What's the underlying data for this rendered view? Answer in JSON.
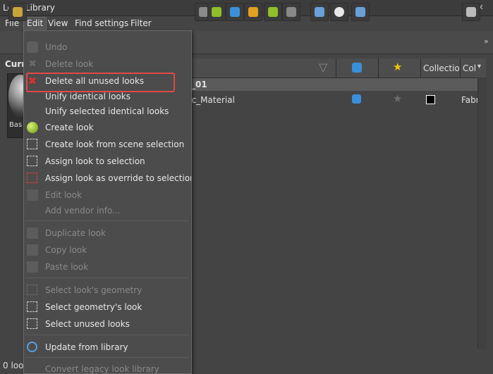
{
  "window": {
    "title": "Look Library"
  },
  "menubar": {
    "file": "File",
    "edit": "Edit",
    "view": "View",
    "find": "Find settings",
    "filter": "Filter"
  },
  "left": {
    "current_label": "Curr",
    "thumb_label": "Bas"
  },
  "table": {
    "group_label": "_01",
    "row_name": "sic_Material",
    "header_collection": "Collectio",
    "header_col": "Col",
    "row_col": "Fabric"
  },
  "status": "0 loo",
  "edit_menu": {
    "undo": "Undo",
    "delete_look": "Delete look",
    "delete_all_unused": "Delete all unused looks",
    "unify_identical": "Unify identical looks",
    "unify_selected": "Unify selected identical looks",
    "create_look": "Create look",
    "create_from_scene": "Create look from scene selection",
    "assign_to_selection": "Assign look to selection",
    "assign_override": "Assign look as override to selection",
    "edit_look": "Edit look",
    "add_vendor": "Add vendor info...",
    "duplicate_look": "Duplicate look",
    "copy_look": "Copy look",
    "paste_look": "Paste look",
    "select_look_geometry": "Select look's geometry",
    "select_geometry_look": "Select geometry's look",
    "select_unused": "Select unused looks",
    "update_from_library": "Update from library",
    "convert_legacy": "Convert legacy look library"
  },
  "colors": {
    "highlight": "#e04848",
    "star": "#f4c20d"
  }
}
